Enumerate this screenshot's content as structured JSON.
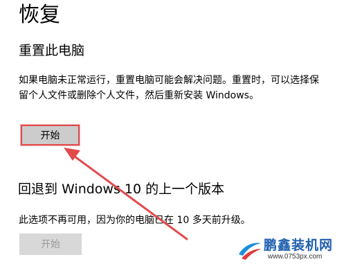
{
  "page": {
    "title": "恢复"
  },
  "reset_section": {
    "title": "重置此电脑",
    "description": "如果电脑未正常运行，重置电脑可能会解决问题。重置时，可以选择保留个人文件或删除个人文件，然后重新安装 Windows。",
    "button_label": "开始",
    "button_highlight_color": "#e24a4a"
  },
  "goback_section": {
    "title": "回退到 Windows 10 的上一个版本",
    "description": "此选项不再可用，因为你的电脑已在 10 多天前升级。",
    "button_label": "开始",
    "button_state": "disabled"
  },
  "annotation": {
    "arrow_color": "#e24a4a",
    "arrow_target": "reset-start-button"
  },
  "watermark": {
    "brand": "鹏鑫装机网",
    "url": "www.0753px.com",
    "logo_icon": "swoosh-logo-icon"
  }
}
